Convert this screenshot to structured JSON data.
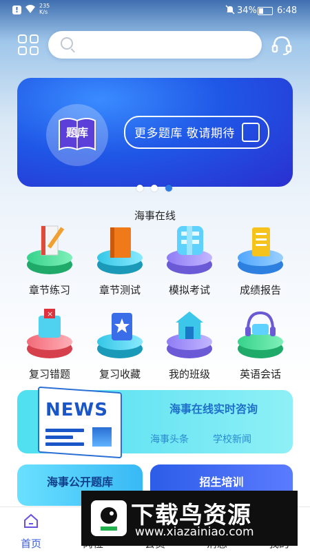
{
  "status_bar": {
    "alert_glyph": "!",
    "speed_value": "235",
    "speed_unit": "K/s",
    "battery_pct": "34%",
    "time": "6:48"
  },
  "header": {
    "search": {
      "value": "",
      "placeholder": ""
    }
  },
  "banner": {
    "book_label": "题库",
    "pill_text": "更多题库  敬请期待",
    "dots": [
      false,
      false,
      true
    ]
  },
  "section_title": "海事在线",
  "features": [
    {
      "label": "章节练习",
      "icon": "certificate-pencil-icon"
    },
    {
      "label": "章节测试",
      "icon": "book-stack-icon"
    },
    {
      "label": "模拟考试",
      "icon": "exam-character-icon"
    },
    {
      "label": "成绩报告",
      "icon": "report-100-icon"
    },
    {
      "label": "复习错题",
      "icon": "wrong-questions-icon"
    },
    {
      "label": "复习收藏",
      "icon": "bookmark-star-icon"
    },
    {
      "label": "我的班级",
      "icon": "house-icon"
    },
    {
      "label": "英语会话",
      "icon": "headphones-abc-icon"
    }
  ],
  "consult": {
    "news_label": "NEWS",
    "title": "海事在线实时咨询",
    "link1": "海事头条",
    "link2": "学校新闻"
  },
  "cards": {
    "left": "海事公开题库",
    "right": "招生培训"
  },
  "tabs": [
    {
      "label": "首页",
      "active": true
    },
    {
      "label": "岗位",
      "active": false
    },
    {
      "label": "会员",
      "active": false
    },
    {
      "label": "消息",
      "active": false
    },
    {
      "label": "我的",
      "active": false
    }
  ],
  "watermark": {
    "title": "下载鸟资源",
    "url": "www.xiazainiao.com"
  },
  "colors": {
    "accent": "#3b5bdb",
    "banner_blue": "#1f57e6",
    "consult_cyan": "#4fe0f0"
  }
}
